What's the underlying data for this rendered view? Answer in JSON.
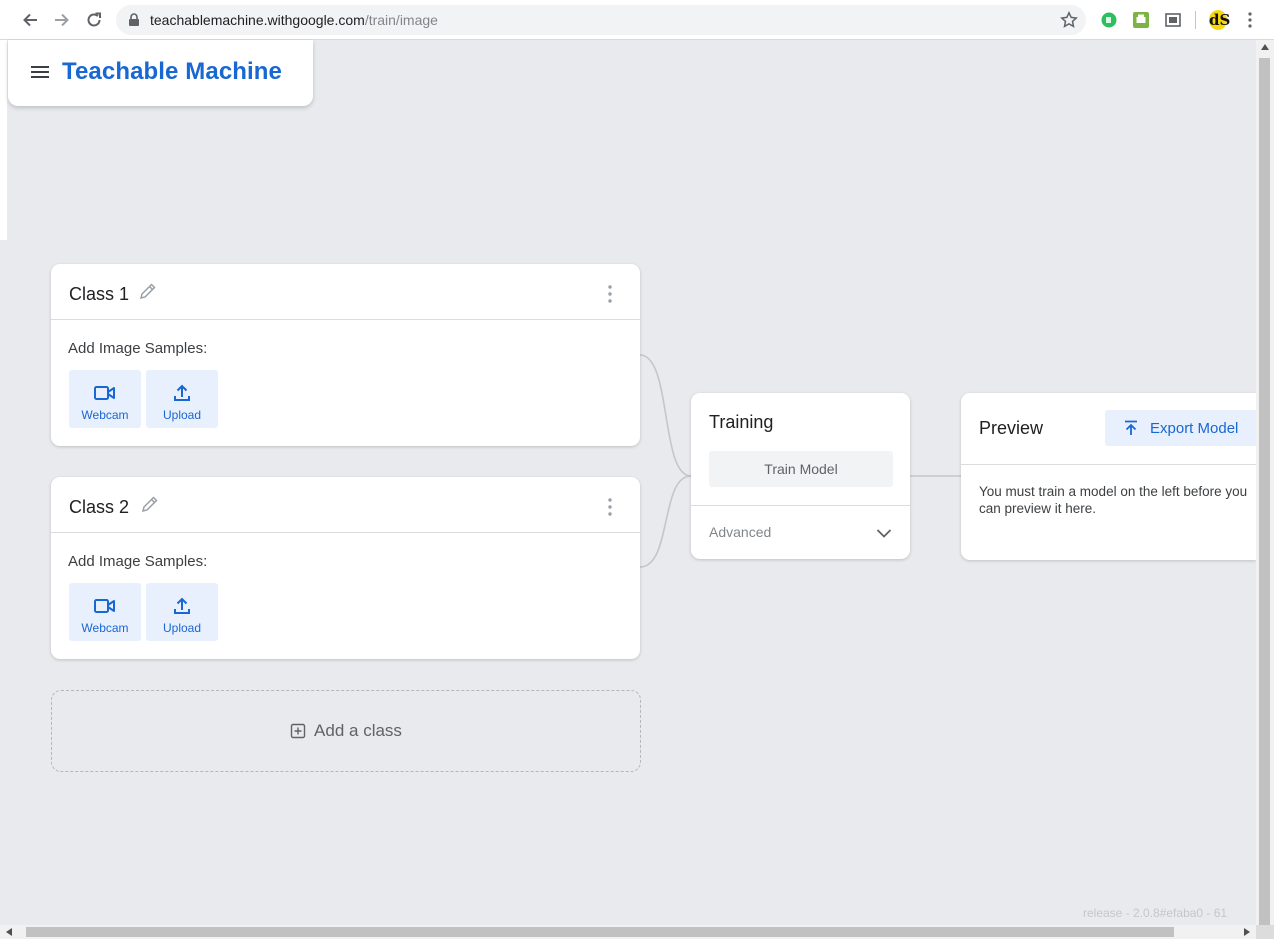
{
  "browser": {
    "url_host": "teachablemachine.withgoogle.com",
    "url_path": "/train/image",
    "back_icon": "arrow-left-icon",
    "forward_icon": "arrow-right-icon",
    "reload_icon": "reload-icon",
    "profile_label": "dS"
  },
  "app": {
    "title": "Teachable Machine"
  },
  "classes": [
    {
      "name": "Class 1",
      "samples_label": "Add Image Samples:",
      "webcam_label": "Webcam",
      "upload_label": "Upload"
    },
    {
      "name": "Class 2",
      "samples_label": "Add Image Samples:",
      "webcam_label": "Webcam",
      "upload_label": "Upload"
    }
  ],
  "add_class": {
    "label": "Add a class"
  },
  "training": {
    "title": "Training",
    "train_button": "Train Model",
    "advanced_label": "Advanced"
  },
  "preview": {
    "title": "Preview",
    "export_button": "Export Model",
    "message": "You must train a model on the left before you can preview it here."
  },
  "footer": {
    "release": "release - 2.0.8#efaba0 - 61"
  },
  "colors": {
    "accent": "#1967d2",
    "background": "#e8eaed",
    "button_bg": "#e8f0fe"
  }
}
